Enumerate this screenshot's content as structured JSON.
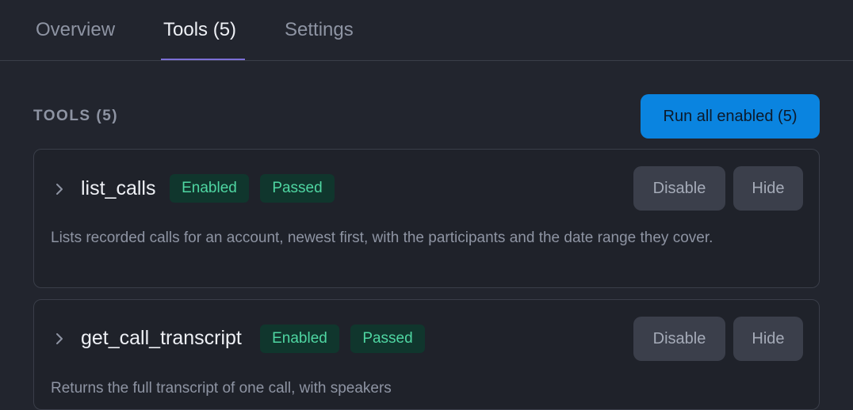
{
  "tabs": [
    {
      "label": "Overview",
      "active": false
    },
    {
      "label": "Tools (5)",
      "active": true
    },
    {
      "label": "Settings",
      "active": false
    }
  ],
  "section": {
    "title": "TOOLS (5)",
    "run_all_label": "Run all enabled (5)"
  },
  "tools": [
    {
      "name": "list_calls",
      "status": "Enabled",
      "result": "Passed",
      "disable_label": "Disable",
      "hide_label": "Hide",
      "description": "Lists recorded calls for an account, newest first, with the participants and the date range they cover."
    },
    {
      "name": "get_call_transcript",
      "status": "Enabled",
      "result": "Passed",
      "disable_label": "Disable",
      "hide_label": "Hide",
      "description": "Returns the full transcript of one call, with speakers"
    }
  ],
  "colors": {
    "background": "#22252e",
    "accent": "#0a84e0",
    "tab_indicator": "#7c6fd6",
    "badge_text": "#4fd6a2",
    "badge_bg": "#10362d"
  }
}
